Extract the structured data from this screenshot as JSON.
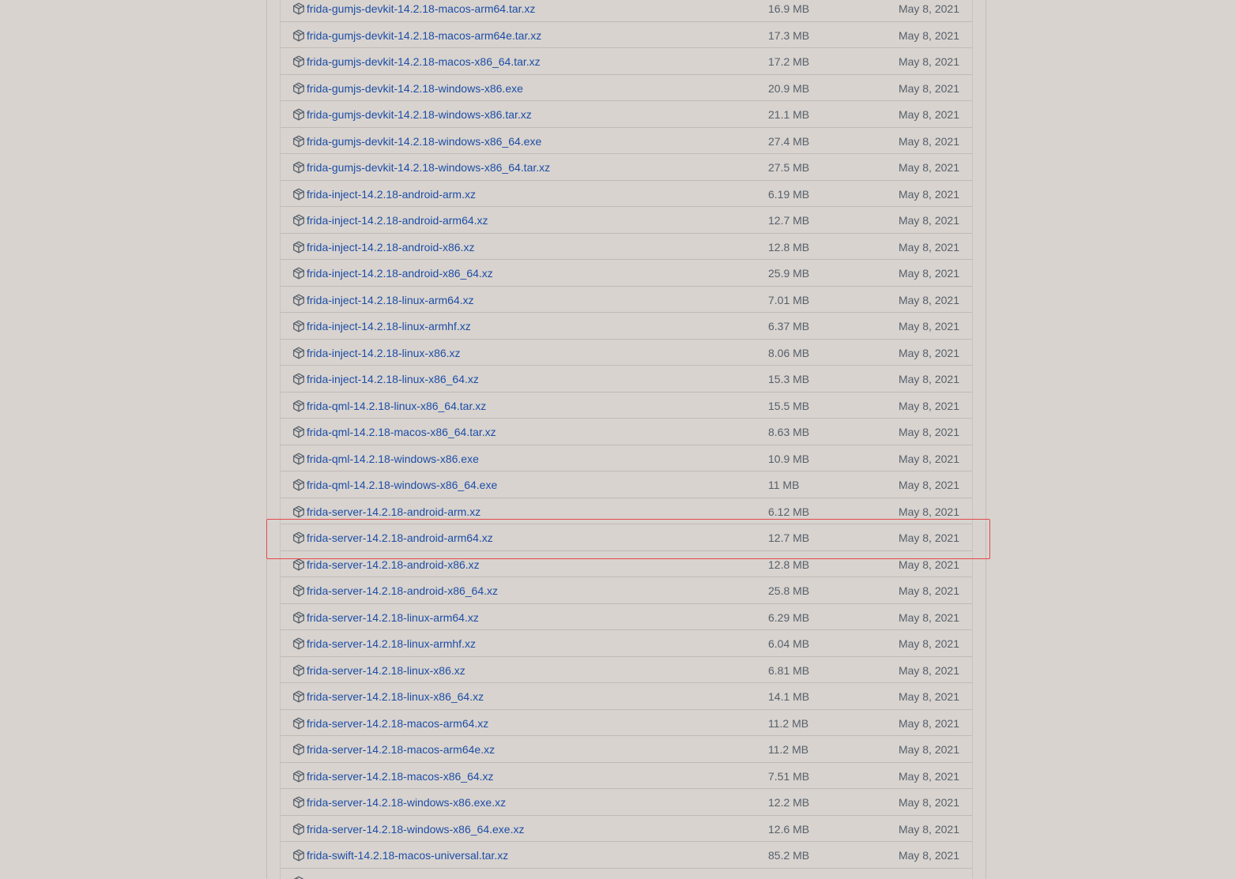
{
  "assets": [
    {
      "name": "frida-gumjs-devkit-14.2.18-macos-arm64.tar.xz",
      "size": "16.9 MB",
      "date": "May 8, 2021"
    },
    {
      "name": "frida-gumjs-devkit-14.2.18-macos-arm64e.tar.xz",
      "size": "17.3 MB",
      "date": "May 8, 2021"
    },
    {
      "name": "frida-gumjs-devkit-14.2.18-macos-x86_64.tar.xz",
      "size": "17.2 MB",
      "date": "May 8, 2021"
    },
    {
      "name": "frida-gumjs-devkit-14.2.18-windows-x86.exe",
      "size": "20.9 MB",
      "date": "May 8, 2021"
    },
    {
      "name": "frida-gumjs-devkit-14.2.18-windows-x86.tar.xz",
      "size": "21.1 MB",
      "date": "May 8, 2021"
    },
    {
      "name": "frida-gumjs-devkit-14.2.18-windows-x86_64.exe",
      "size": "27.4 MB",
      "date": "May 8, 2021"
    },
    {
      "name": "frida-gumjs-devkit-14.2.18-windows-x86_64.tar.xz",
      "size": "27.5 MB",
      "date": "May 8, 2021"
    },
    {
      "name": "frida-inject-14.2.18-android-arm.xz",
      "size": "6.19 MB",
      "date": "May 8, 2021"
    },
    {
      "name": "frida-inject-14.2.18-android-arm64.xz",
      "size": "12.7 MB",
      "date": "May 8, 2021"
    },
    {
      "name": "frida-inject-14.2.18-android-x86.xz",
      "size": "12.8 MB",
      "date": "May 8, 2021"
    },
    {
      "name": "frida-inject-14.2.18-android-x86_64.xz",
      "size": "25.9 MB",
      "date": "May 8, 2021"
    },
    {
      "name": "frida-inject-14.2.18-linux-arm64.xz",
      "size": "7.01 MB",
      "date": "May 8, 2021"
    },
    {
      "name": "frida-inject-14.2.18-linux-armhf.xz",
      "size": "6.37 MB",
      "date": "May 8, 2021"
    },
    {
      "name": "frida-inject-14.2.18-linux-x86.xz",
      "size": "8.06 MB",
      "date": "May 8, 2021"
    },
    {
      "name": "frida-inject-14.2.18-linux-x86_64.xz",
      "size": "15.3 MB",
      "date": "May 8, 2021"
    },
    {
      "name": "frida-qml-14.2.18-linux-x86_64.tar.xz",
      "size": "15.5 MB",
      "date": "May 8, 2021"
    },
    {
      "name": "frida-qml-14.2.18-macos-x86_64.tar.xz",
      "size": "8.63 MB",
      "date": "May 8, 2021"
    },
    {
      "name": "frida-qml-14.2.18-windows-x86.exe",
      "size": "10.9 MB",
      "date": "May 8, 2021"
    },
    {
      "name": "frida-qml-14.2.18-windows-x86_64.exe",
      "size": "11 MB",
      "date": "May 8, 2021"
    },
    {
      "name": "frida-server-14.2.18-android-arm.xz",
      "size": "6.12 MB",
      "date": "May 8, 2021"
    },
    {
      "name": "frida-server-14.2.18-android-arm64.xz",
      "size": "12.7 MB",
      "date": "May 8, 2021"
    },
    {
      "name": "frida-server-14.2.18-android-x86.xz",
      "size": "12.8 MB",
      "date": "May 8, 2021"
    },
    {
      "name": "frida-server-14.2.18-android-x86_64.xz",
      "size": "25.8 MB",
      "date": "May 8, 2021"
    },
    {
      "name": "frida-server-14.2.18-linux-arm64.xz",
      "size": "6.29 MB",
      "date": "May 8, 2021"
    },
    {
      "name": "frida-server-14.2.18-linux-armhf.xz",
      "size": "6.04 MB",
      "date": "May 8, 2021"
    },
    {
      "name": "frida-server-14.2.18-linux-x86.xz",
      "size": "6.81 MB",
      "date": "May 8, 2021"
    },
    {
      "name": "frida-server-14.2.18-linux-x86_64.xz",
      "size": "14.1 MB",
      "date": "May 8, 2021"
    },
    {
      "name": "frida-server-14.2.18-macos-arm64.xz",
      "size": "11.2 MB",
      "date": "May 8, 2021"
    },
    {
      "name": "frida-server-14.2.18-macos-arm64e.xz",
      "size": "11.2 MB",
      "date": "May 8, 2021"
    },
    {
      "name": "frida-server-14.2.18-macos-x86_64.xz",
      "size": "7.51 MB",
      "date": "May 8, 2021"
    },
    {
      "name": "frida-server-14.2.18-windows-x86.exe.xz",
      "size": "12.2 MB",
      "date": "May 8, 2021"
    },
    {
      "name": "frida-server-14.2.18-windows-x86_64.exe.xz",
      "size": "12.6 MB",
      "date": "May 8, 2021"
    },
    {
      "name": "frida-swift-14.2.18-macos-universal.tar.xz",
      "size": "85.2 MB",
      "date": "May 8, 2021"
    },
    {
      "name": "",
      "size": "",
      "date": ""
    }
  ],
  "highlighted_asset": "frida-server-14.2.18-android-arm64.xz",
  "colors": {
    "link": "#1d4ea6",
    "muted_text": "#57606a",
    "highlight_border": "#e5484d",
    "background": "#d8d3cf"
  },
  "icons": {
    "asset": "package-icon"
  }
}
